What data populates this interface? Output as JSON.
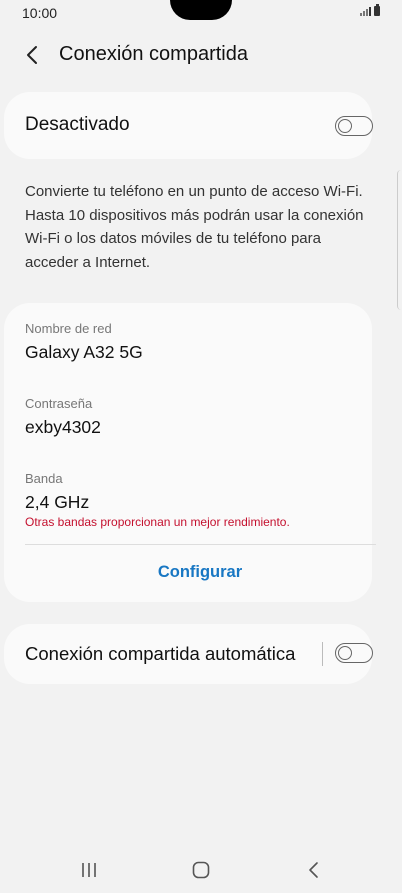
{
  "status": {
    "time": "10:00"
  },
  "header": {
    "title": "Conexión compartida"
  },
  "hotspot": {
    "state_label": "Desactivado",
    "enabled": false
  },
  "description": "Convierte tu teléfono en un punto de acceso Wi-Fi. Hasta 10 dispositivos más podrán usar la conexión Wi-Fi o los datos móviles de tu teléfono para acceder a Internet.",
  "network": {
    "name_label": "Nombre de red",
    "name_value": "Galaxy A32 5G",
    "password_label": "Contraseña",
    "password_value": "exby4302",
    "band_label": "Banda",
    "band_value": "2,4 GHz",
    "band_warning": "Otras bandas proporcionan un mejor rendimiento.",
    "configure_label": "Configurar"
  },
  "auto_hotspot": {
    "label": "Conexión compartida automática",
    "enabled": false
  },
  "nav": {
    "icons": [
      "recent-apps-icon",
      "home-icon",
      "back-icon"
    ]
  },
  "colors": {
    "accent": "#1877c3",
    "warning": "#c4102e"
  }
}
